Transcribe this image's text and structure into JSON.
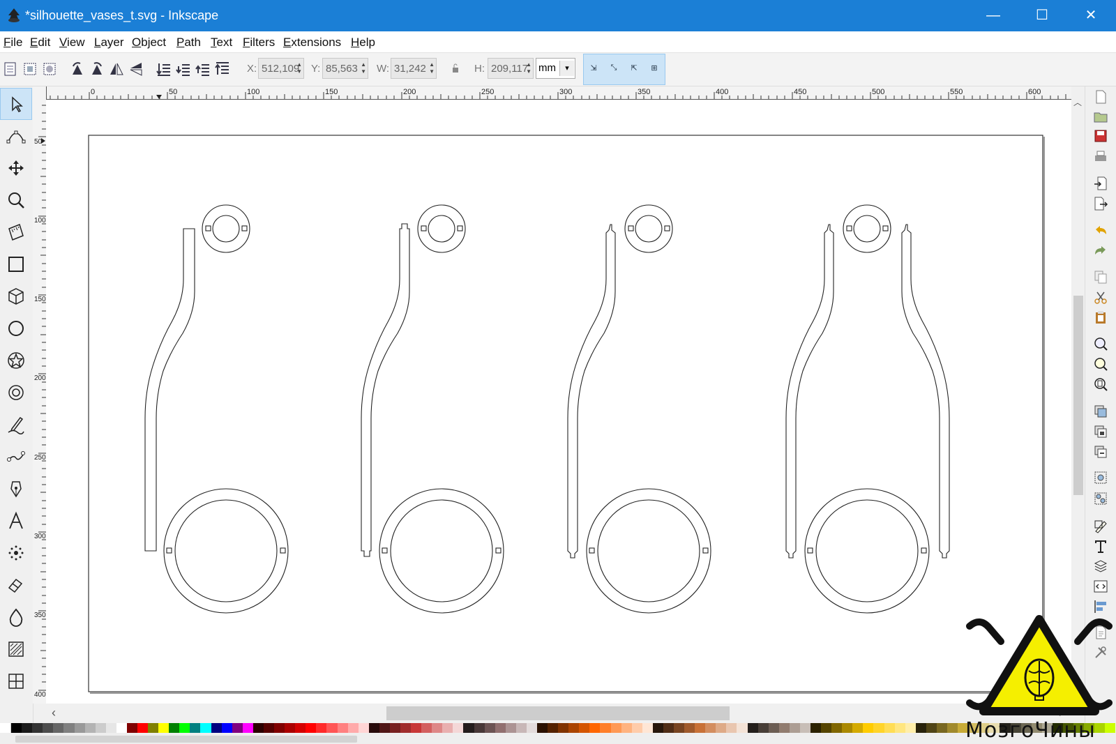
{
  "window": {
    "title": "*silhouette_vases_t.svg - Inkscape",
    "controls": [
      "—",
      "☐",
      "✕"
    ]
  },
  "menu": [
    "File",
    "Edit",
    "View",
    "Layer",
    "Object",
    "Path",
    "Text",
    "Filters",
    "Extensions",
    "Help"
  ],
  "toolbar": {
    "x_label": "X:",
    "x_value": "512,109",
    "y_label": "Y:",
    "y_value": "85,563",
    "w_label": "W:",
    "w_value": "31,242",
    "h_label": "H:",
    "h_value": "209,117",
    "unit": "mm"
  },
  "ruler": {
    "top_labels": [
      "0",
      "50",
      "100",
      "150",
      "200",
      "250",
      "300",
      "350",
      "400",
      "450",
      "500",
      "550",
      "600"
    ],
    "left_labels": [
      "50",
      "100",
      "150",
      "200",
      "250",
      "300",
      "350",
      "400"
    ]
  },
  "tools": [
    "selector",
    "node",
    "tweak",
    "zoom",
    "measure",
    "rectangle",
    "3d-box",
    "ellipse",
    "star",
    "spiral",
    "pencil",
    "bezier",
    "calligraphy",
    "text",
    "spray",
    "eraser",
    "paint-bucket",
    "gradient",
    "mesh"
  ],
  "watermark": {
    "text": "МозгоЧины",
    "colors": {
      "triangle": "#f5ef00",
      "outline": "#111111"
    }
  },
  "colors": {
    "titlebar": "#1b7fd6",
    "selected_tool": "#cce4f7"
  }
}
